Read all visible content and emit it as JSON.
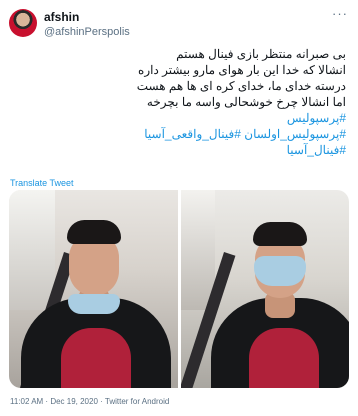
{
  "tweet": {
    "name": "afshin",
    "handle": "@afshinPerspolis",
    "more": "···",
    "lines": [
      "بی صبرانه منتظر بازی فینال هستم",
      "انشالا که خدا این بار هوای مارو بیشتر داره",
      "درسته خدای ما، خدای کره ای ها هم هست",
      "اما انشالا چرخ خوشحالی واسه ما بچرخه"
    ],
    "hashtags": [
      "#پرسپولیس",
      "#پرسپولیس_اولسان #فینال_واقعی_آسیا",
      "#فینال_آسیا"
    ],
    "translate": "Translate Tweet",
    "meta": "11:02 AM · Dec 19, 2020 · Twitter for Android"
  }
}
